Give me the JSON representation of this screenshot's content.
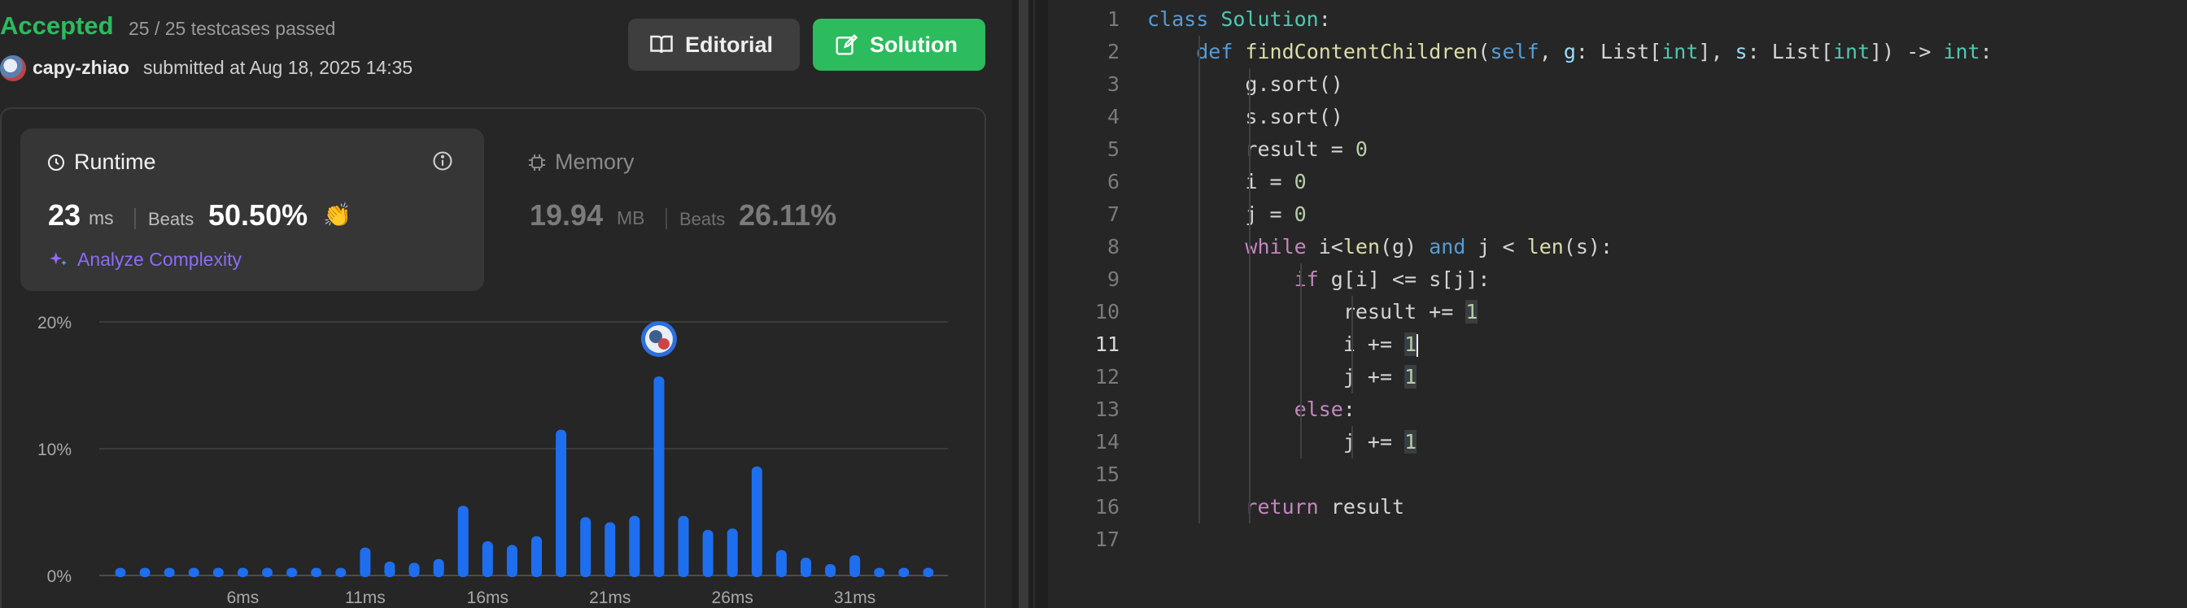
{
  "submission": {
    "status": "Accepted",
    "testcases": "25 / 25 testcases passed",
    "username": "capy-zhiao",
    "submitted_text": "submitted at Aug 18, 2025 14:35"
  },
  "buttons": {
    "editorial": "Editorial",
    "solution": "Solution"
  },
  "runtime": {
    "title": "Runtime",
    "value": "23",
    "unit": "ms",
    "beats_label": "Beats",
    "beats_pct": "50.50%",
    "analyze": "Analyze Complexity"
  },
  "memory": {
    "title": "Memory",
    "value": "19.94",
    "unit": "MB",
    "beats_label": "Beats",
    "beats_pct": "26.11%"
  },
  "colors": {
    "accepted": "#2cbb5d",
    "bar": "#1e6fef",
    "analyze": "#8c6cf4"
  },
  "chart_data": {
    "type": "bar",
    "y_ticks": [
      "0%",
      "10%",
      "20%"
    ],
    "ylim": [
      0,
      20
    ],
    "x_tick_labels": [
      "6ms",
      "11ms",
      "16ms",
      "21ms",
      "26ms",
      "31ms"
    ],
    "values": [
      0.6,
      0.6,
      0.6,
      0.6,
      0.6,
      0.6,
      0.6,
      0.6,
      0.6,
      0.6,
      2.2,
      1.1,
      1.0,
      1.3,
      5.5,
      2.7,
      2.4,
      3.1,
      11.5,
      4.6,
      4.2,
      4.7,
      15.7,
      4.7,
      3.6,
      3.7,
      8.6,
      2.0,
      1.4,
      0.9,
      1.6,
      0.6,
      0.6,
      0.6
    ],
    "highlight_index": 22
  },
  "editor": {
    "active_line": 11,
    "lines": [
      "class Solution:",
      "    def findContentChildren(self, g: List[int], s: List[int]) -> int:",
      "        g.sort()",
      "        s.sort()",
      "        result = 0",
      "        i = 0",
      "        j = 0",
      "        while i<len(g) and j < len(s):",
      "            if g[i] <= s[j]:",
      "                result += 1",
      "                i += 1",
      "                j += 1",
      "            else:",
      "                j += 1",
      "",
      "        return result",
      ""
    ]
  }
}
